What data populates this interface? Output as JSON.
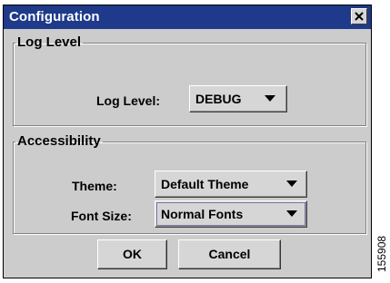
{
  "window": {
    "title": "Configuration",
    "close_icon": "close-icon"
  },
  "log_level_group": {
    "legend": "Log Level",
    "label": "Log Level:",
    "selected": "DEBUG"
  },
  "accessibility_group": {
    "legend": "Accessibility",
    "theme_label": "Theme:",
    "theme_selected": "Default Theme",
    "font_size_label": "Font Size:",
    "font_size_selected": "Normal Fonts"
  },
  "buttons": {
    "ok": "OK",
    "cancel": "Cancel"
  },
  "figure_id": "155908",
  "colors": {
    "titlebar": "#1f3a8a",
    "dialog_bg": "#cccccc",
    "control_bg": "#d6d6d6"
  }
}
